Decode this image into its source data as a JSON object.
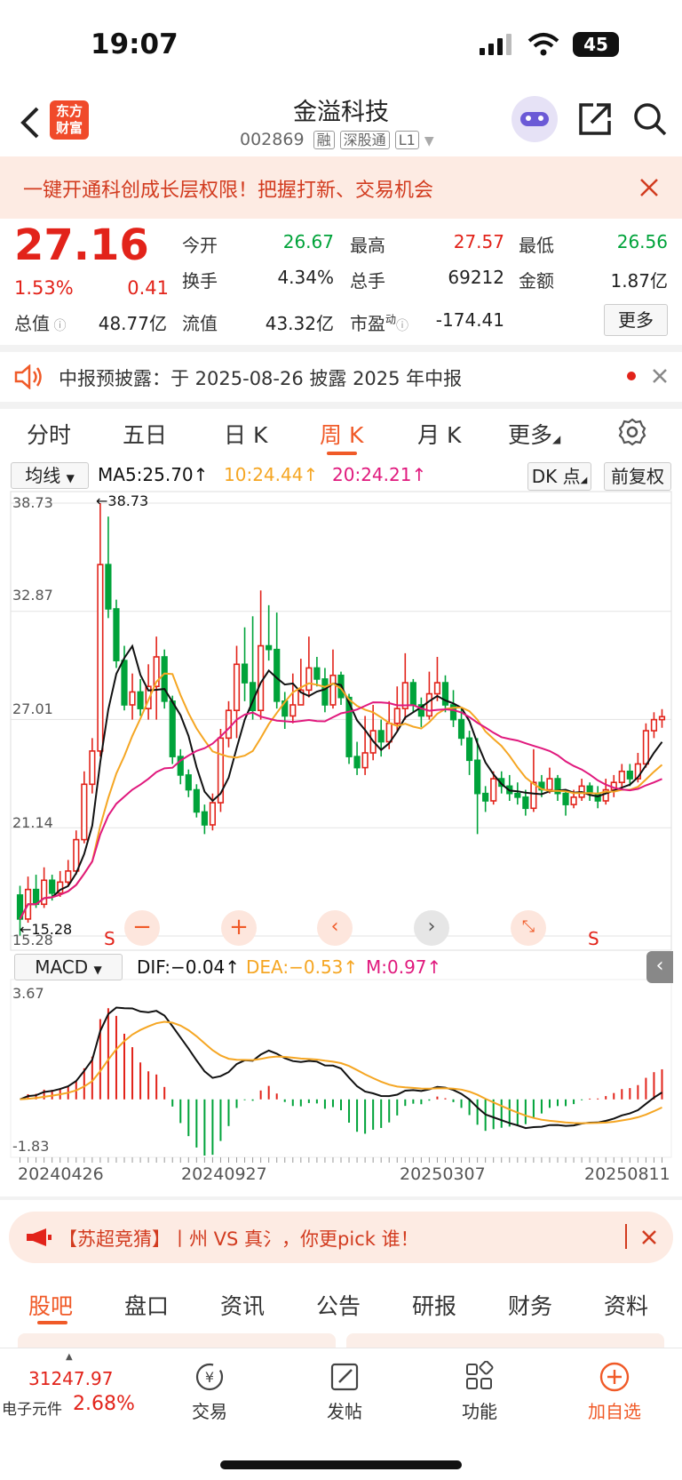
{
  "status": {
    "time": "19:07",
    "battery": "45"
  },
  "header": {
    "logo": [
      "东方",
      "财富"
    ],
    "title": "金溢科技",
    "code": "002869",
    "tags": [
      "融",
      "深股通",
      "L1"
    ]
  },
  "banner": {
    "text": "一键开通科创成长层权限！把握打新、交易机会"
  },
  "quote": {
    "price": "27.16",
    "pct": "1.53%",
    "chg": "0.41",
    "rows": [
      [
        {
          "k": "今开",
          "v": "26.67",
          "c": "green"
        },
        {
          "k": "最高",
          "v": "27.57",
          "c": "red"
        },
        {
          "k": "最低",
          "v": "26.56",
          "c": "green"
        }
      ],
      [
        {
          "k": "换手",
          "v": "4.34%",
          "c": ""
        },
        {
          "k": "总手",
          "v": "69212",
          "c": ""
        },
        {
          "k": "金额",
          "v": "1.87亿",
          "c": ""
        }
      ]
    ],
    "row3": [
      {
        "k": "总值",
        "v": "48.77亿"
      },
      {
        "k": "流值",
        "v": "43.32亿"
      },
      {
        "k": "市盈",
        "sup": "动",
        "v": "-174.41"
      }
    ],
    "more": "更多"
  },
  "notice": {
    "text": "中报预披露：于 2025-08-26 披露 2025 年中报"
  },
  "tabs": [
    "分时",
    "五日",
    "日 K",
    "周 K",
    "月 K",
    "更多"
  ],
  "chart": {
    "indicator": "均线",
    "ma5": "MA5:25.70↑",
    "ma10": "10:24.44↑",
    "ma20": "20:24.21↑",
    "dk": "DK 点",
    "fq": "前复权",
    "yticks": [
      "38.73",
      "32.87",
      "27.01",
      "21.14",
      "15.28"
    ],
    "max_label": "←38.73",
    "min_label": "←15.28",
    "macd_label": "MACD",
    "dif": "DIF:−0.04↑",
    "dea": "DEA:−0.53↑",
    "m": "M:0.97↑",
    "macd_top": "3.67",
    "macd_bottom": "-1.83",
    "dates": [
      "20240426",
      "20240927",
      "20250307",
      "20250811"
    ],
    "s_marks": [
      "S",
      "S"
    ],
    "colors": {
      "up": "#e2231a",
      "down": "#00a33a",
      "ma5": "#111111",
      "ma10": "#f5a623",
      "ma20": "#e0197d"
    }
  },
  "chart_data": {
    "type": "candlestick",
    "ylim": [
      15.28,
      38.73
    ],
    "candles": [
      [
        17.5,
        16.2,
        18.0,
        15.3
      ],
      [
        16.2,
        17.8,
        18.5,
        16.0
      ],
      [
        17.8,
        17.0,
        18.6,
        16.8
      ],
      [
        17.0,
        18.3,
        19.0,
        16.8
      ],
      [
        18.3,
        17.6,
        18.6,
        17.2
      ],
      [
        17.6,
        18.2,
        18.8,
        17.4
      ],
      [
        18.2,
        18.8,
        19.4,
        18.0
      ],
      [
        18.8,
        20.5,
        21.0,
        18.6
      ],
      [
        20.5,
        23.5,
        24.2,
        20.3
      ],
      [
        23.5,
        25.3,
        26.0,
        23.0
      ],
      [
        25.3,
        35.4,
        38.73,
        25.0
      ],
      [
        35.4,
        33.0,
        38.0,
        32.5
      ],
      [
        33.0,
        30.2,
        33.5,
        29.8
      ],
      [
        30.2,
        27.8,
        31.0,
        27.5
      ],
      [
        27.8,
        28.5,
        29.5,
        27.0
      ],
      [
        28.5,
        27.6,
        29.2,
        27.2
      ],
      [
        27.6,
        28.8,
        30.0,
        27.0
      ],
      [
        28.8,
        30.4,
        31.5,
        27.0
      ],
      [
        30.4,
        28.0,
        30.8,
        27.6
      ],
      [
        28.0,
        25.0,
        28.3,
        24.6
      ],
      [
        25.0,
        24.0,
        25.4,
        23.5
      ],
      [
        24.0,
        23.2,
        24.3,
        22.8
      ],
      [
        23.2,
        22.0,
        23.5,
        21.7
      ],
      [
        22.0,
        21.3,
        22.4,
        20.8
      ],
      [
        21.3,
        22.5,
        23.0,
        21.0
      ],
      [
        22.5,
        26.0,
        26.5,
        22.0
      ],
      [
        26.0,
        27.5,
        28.0,
        25.5
      ],
      [
        27.5,
        30.0,
        31.0,
        26.0
      ],
      [
        30.0,
        29.0,
        32.0,
        28.0
      ],
      [
        29.0,
        27.5,
        32.6,
        27.0
      ],
      [
        27.5,
        31.0,
        34.0,
        27.0
      ],
      [
        31.0,
        30.8,
        33.2,
        30.2
      ],
      [
        30.8,
        28.0,
        32.8,
        27.6
      ],
      [
        28.0,
        27.2,
        28.5,
        26.5
      ],
      [
        27.2,
        27.8,
        29.5,
        26.8
      ],
      [
        27.8,
        28.6,
        30.3,
        28.0
      ],
      [
        28.6,
        29.8,
        31.5,
        28.2
      ],
      [
        29.8,
        29.2,
        30.4,
        28.8
      ],
      [
        29.2,
        27.8,
        29.8,
        27.4
      ],
      [
        27.8,
        29.4,
        30.8,
        27.6
      ],
      [
        29.4,
        28.2,
        29.6,
        27.8
      ],
      [
        28.2,
        25.0,
        28.4,
        24.6
      ],
      [
        25.0,
        24.4,
        25.8,
        24.0
      ],
      [
        24.4,
        25.2,
        27.2,
        24.0
      ],
      [
        25.2,
        26.4,
        27.8,
        24.8
      ],
      [
        26.4,
        25.8,
        27.0,
        25.0
      ],
      [
        25.8,
        26.8,
        28.0,
        25.4
      ],
      [
        26.8,
        27.6,
        28.8,
        26.4
      ],
      [
        27.6,
        29.0,
        30.6,
        27.0
      ],
      [
        29.0,
        27.8,
        29.2,
        27.4
      ],
      [
        27.8,
        27.2,
        28.2,
        26.6
      ],
      [
        27.2,
        28.4,
        29.6,
        27.0
      ],
      [
        28.4,
        29.0,
        30.4,
        28.0
      ],
      [
        29.0,
        27.8,
        29.4,
        27.4
      ],
      [
        27.8,
        27.0,
        28.6,
        26.6
      ],
      [
        27.0,
        26.0,
        27.6,
        25.6
      ],
      [
        26.0,
        24.8,
        26.4,
        24.0
      ],
      [
        24.8,
        23.0,
        26.0,
        20.8
      ],
      [
        23.0,
        22.6,
        23.4,
        22.0
      ],
      [
        22.6,
        23.8,
        24.2,
        22.4
      ],
      [
        23.8,
        23.4,
        24.2,
        23.0
      ],
      [
        23.4,
        23.0,
        24.0,
        22.6
      ],
      [
        23.0,
        22.8,
        23.6,
        22.4
      ],
      [
        22.8,
        22.2,
        23.2,
        21.8
      ],
      [
        22.2,
        23.6,
        25.4,
        22.0
      ],
      [
        23.6,
        23.2,
        24.0,
        22.8
      ],
      [
        23.2,
        23.8,
        24.4,
        23.0
      ],
      [
        23.8,
        23.0,
        24.0,
        22.6
      ],
      [
        23.0,
        22.4,
        23.2,
        21.8
      ],
      [
        22.4,
        22.8,
        23.2,
        22.2
      ],
      [
        22.8,
        23.4,
        23.8,
        22.6
      ],
      [
        23.4,
        23.0,
        23.6,
        22.6
      ],
      [
        23.0,
        22.6,
        23.4,
        22.2
      ],
      [
        22.6,
        23.2,
        23.8,
        22.4
      ],
      [
        23.2,
        23.6,
        24.0,
        22.8
      ],
      [
        23.6,
        24.2,
        24.6,
        23.2
      ],
      [
        24.2,
        23.8,
        24.6,
        23.4
      ],
      [
        23.8,
        24.6,
        25.2,
        23.6
      ],
      [
        24.6,
        26.4,
        26.8,
        24.4
      ],
      [
        26.4,
        27.0,
        27.4,
        26.0
      ],
      [
        27.0,
        27.16,
        27.57,
        26.56
      ]
    ],
    "macd_range": [
      -1.83,
      3.67
    ]
  },
  "pill": {
    "text": "【苏超竞猜】丨州 VS 真氵，你更pick 谁！"
  },
  "btabs": [
    "股吧",
    "盘口",
    "资讯",
    "公告",
    "研报",
    "财务",
    "资料"
  ],
  "bottom": {
    "index_value": "31247.97",
    "index_name": "电子元件",
    "index_pct": "2.68%",
    "items": [
      "交易",
      "发帖",
      "功能",
      "加自选"
    ]
  }
}
